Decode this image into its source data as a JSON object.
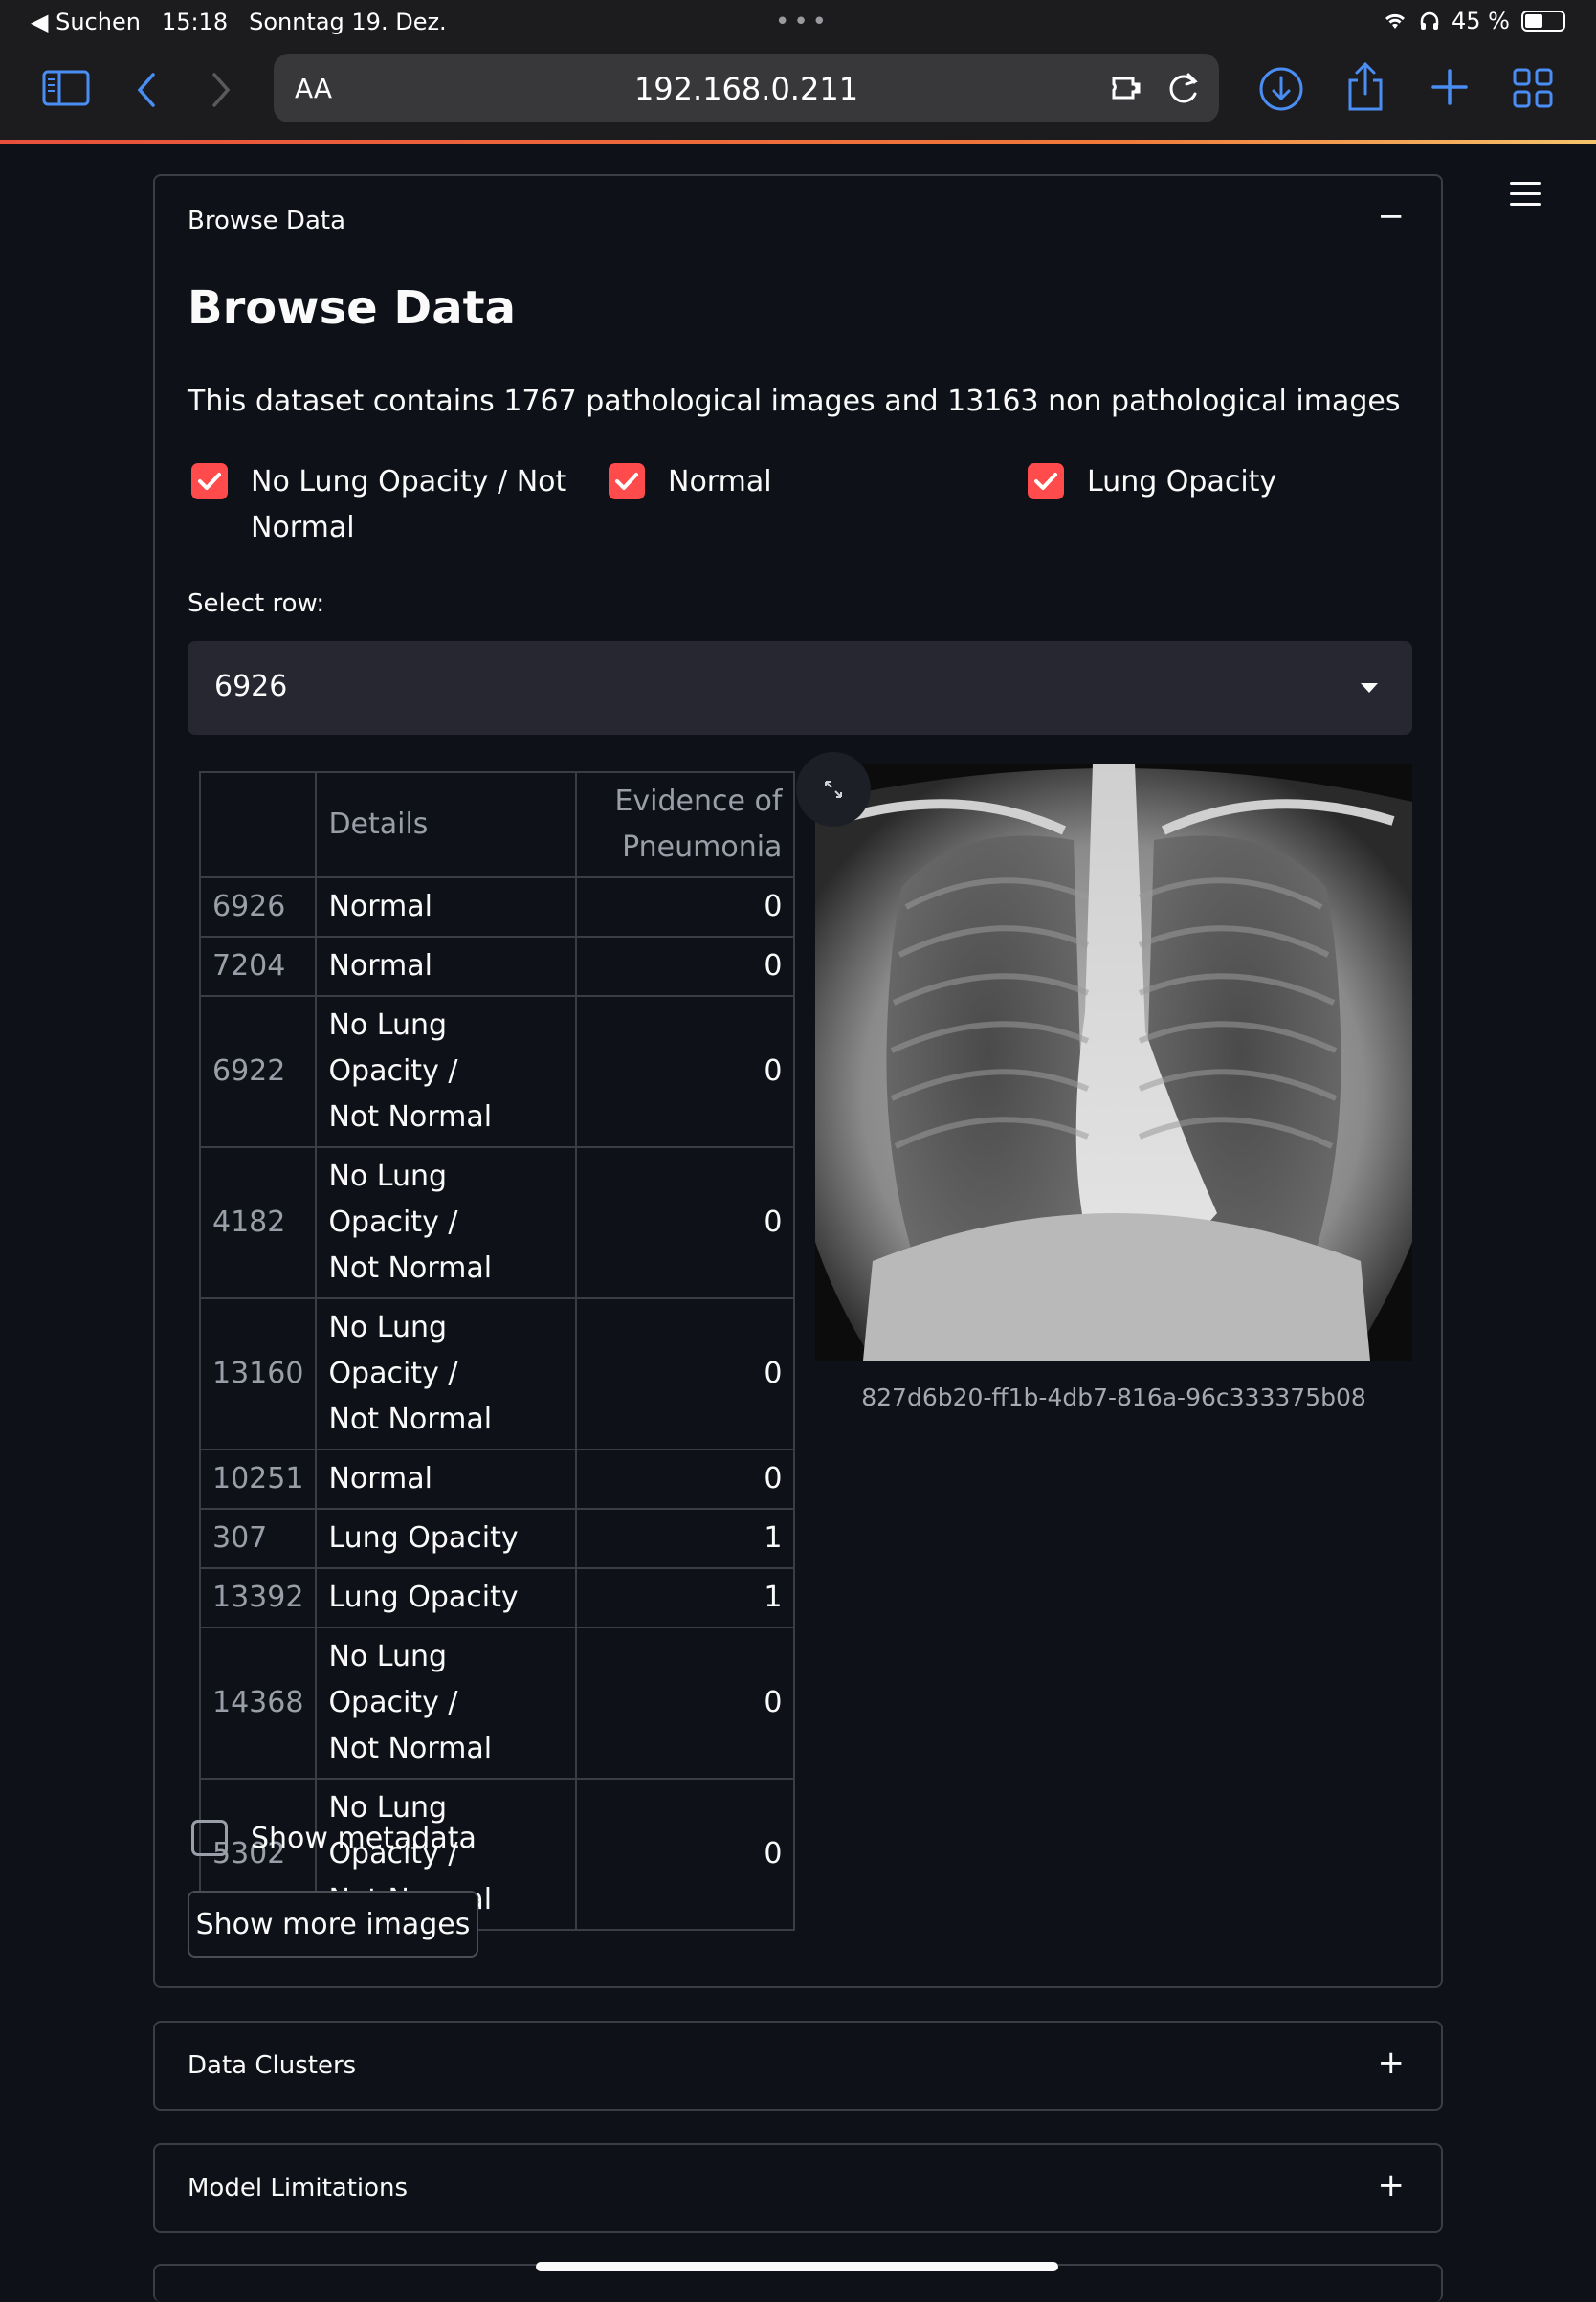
{
  "status_bar": {
    "back_app": "◀ Suchen",
    "time": "15:18",
    "date": "Sonntag 19. Dez.",
    "battery": "45 %",
    "battery_fraction": 0.45
  },
  "browser": {
    "aa_label": "AA",
    "url": "192.168.0.211",
    "accent_color": "#4a8ef4"
  },
  "browse": {
    "header": "Browse Data",
    "toggle": "−",
    "title": "Browse Data",
    "intro": "This dataset contains 1767 pathological images and 13163 non pathological images",
    "filters": [
      {
        "label_line1": "No Lung Opacity / Not",
        "label_line2": "Normal",
        "checked": true
      },
      {
        "label": "Normal",
        "checked": true
      },
      {
        "label": "Lung Opacity",
        "checked": true
      }
    ],
    "select_label": "Select row:",
    "select_value": "6926",
    "table": {
      "columns": [
        "",
        "Details",
        "Evidence of",
        "Pneumonia"
      ],
      "rows": [
        {
          "index": "6926",
          "details": "Normal",
          "evidence": "0"
        },
        {
          "index": "7204",
          "details": "Normal",
          "evidence": "0"
        },
        {
          "index": "6922",
          "details": "No Lung Opacity /",
          "details2": "Not Normal",
          "evidence": "0"
        },
        {
          "index": "4182",
          "details": "No Lung Opacity /",
          "details2": "Not Normal",
          "evidence": "0"
        },
        {
          "index": "13160",
          "details": "No Lung Opacity /",
          "details2": "Not Normal",
          "evidence": "0"
        },
        {
          "index": "10251",
          "details": "Normal",
          "evidence": "0"
        },
        {
          "index": "307",
          "details": "Lung Opacity",
          "evidence": "1"
        },
        {
          "index": "13392",
          "details": "Lung Opacity",
          "evidence": "1"
        },
        {
          "index": "14368",
          "details": "No Lung Opacity /",
          "details2": "Not Normal",
          "evidence": "0"
        },
        {
          "index": "5302",
          "details": "No Lung Opacity /",
          "details2": "Not Normal",
          "evidence": "0"
        }
      ]
    },
    "image_caption": "827d6b20-ff1b-4db7-816a-96c333375b08",
    "show_metadata_label": "Show metadata",
    "show_metadata_checked": false,
    "more_button": "Show more images"
  },
  "sections": [
    {
      "label": "Data Clusters",
      "toggle": "+"
    },
    {
      "label": "Model Limitations",
      "toggle": "+"
    }
  ],
  "colors": {
    "background": "#0e1117",
    "checkbox_red": "#ff4b4b",
    "border": "#3a3d45"
  }
}
